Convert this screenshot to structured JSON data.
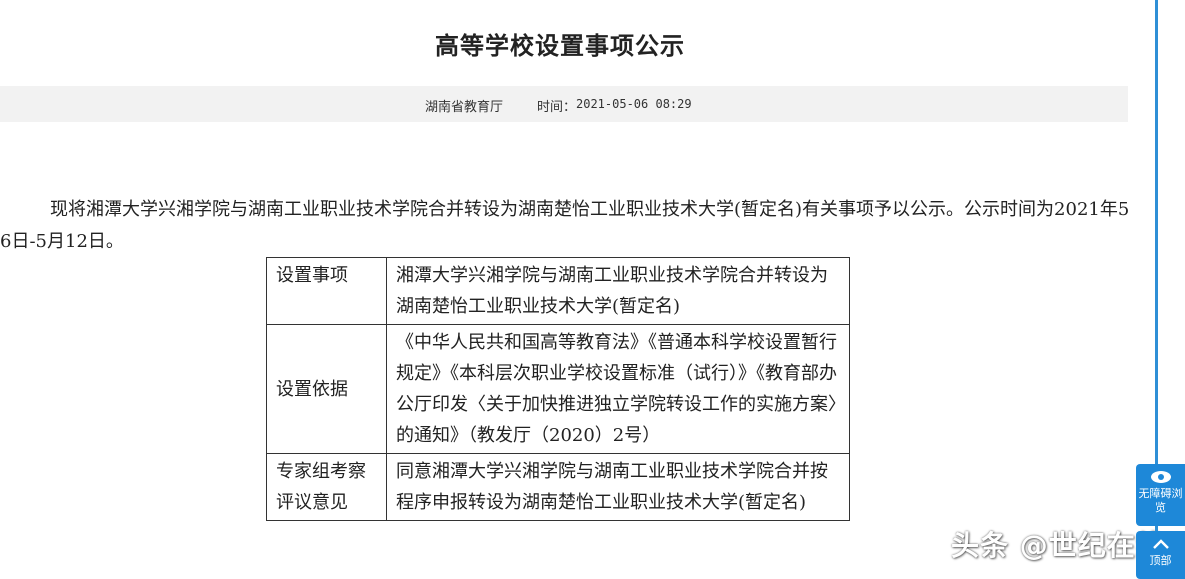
{
  "header": {
    "title": "高等学校设置事项公示"
  },
  "meta": {
    "source": "湖南省教育厅",
    "time_label": "时间：",
    "time_value": "2021-05-06 08:29"
  },
  "body": {
    "intro": "现将湘潭大学兴湘学院与湖南工业职业技术学院合并转设为湖南楚怡工业职业技术大学(暂定名)有关事项予以公示。公示时间为2021年5月6日-5月12日。"
  },
  "table": {
    "rows": [
      {
        "key": "设置事项",
        "value": "湘潭大学兴湘学院与湖南工业职业技术学院合并转设为湖南楚怡工业职业技术大学(暂定名)"
      },
      {
        "key": "设置依据",
        "value": "《中华人民共和国高等教育法》《普通本科学校设置暂行规定》《本科层次职业学校设置标准（试行）》《教育部办公厅印发〈关于加快推进独立学院转设工作的实施方案〉的通知》（教发厅（2020）2号）"
      },
      {
        "key": "专家组考察评议意见",
        "value": "同意湘潭大学兴湘学院与湖南工业职业技术学院合并按程序申报转设为湖南楚怡工业职业技术大学(暂定名)"
      }
    ]
  },
  "overlay": {
    "watermark": "头条 @世纪在线"
  },
  "sidebar": {
    "accessibility_label": "无障碍浏览",
    "top_label": "顶部",
    "accent": "#1e88d8"
  }
}
